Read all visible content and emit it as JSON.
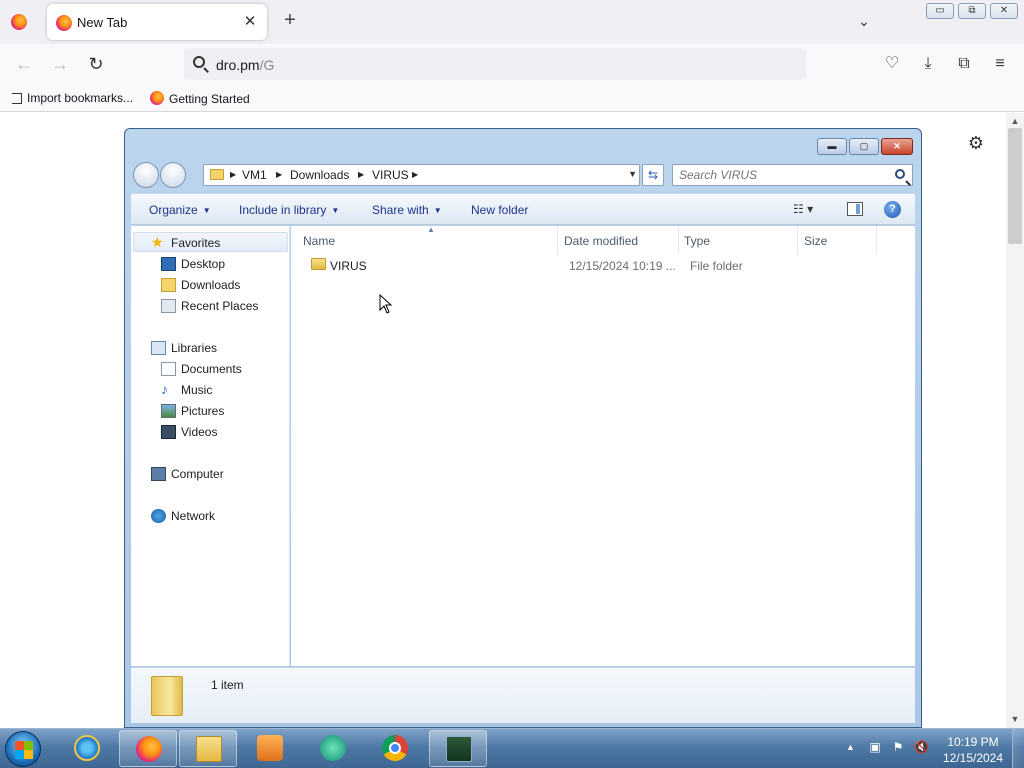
{
  "browser": {
    "tab": {
      "title": "New Tab",
      "close_glyph": "✕"
    },
    "new_tab_glyph": "+",
    "list_tabs_glyph": "⌄",
    "window_controls": {
      "minimize": "▭",
      "restore": "⧉",
      "close": "✕"
    },
    "nav": {
      "back": "←",
      "forward": "→",
      "reload": "↻"
    },
    "url": {
      "host": "dro.pm",
      "path": "/G"
    },
    "toolbar_icons": [
      "pocket-icon",
      "download-icon",
      "extensions-icon",
      "menu-icon"
    ],
    "bookmarks": [
      {
        "label": "Import bookmarks...",
        "icon": "import-icon"
      },
      {
        "label": "Getting Started",
        "icon": "firefox-icon"
      }
    ]
  },
  "explorer": {
    "window_controls": {
      "minimize": "▬",
      "maximize": "▢",
      "close": "✕"
    },
    "breadcrumb": [
      "VM1",
      "Downloads",
      "VIRUS"
    ],
    "search_placeholder": "Search VIRUS",
    "commands": {
      "organize": "Organize",
      "include": "Include in library",
      "share": "Share with",
      "new_folder": "New folder"
    },
    "nav_pane": {
      "favorites": {
        "label": "Favorites",
        "items": [
          "Desktop",
          "Downloads",
          "Recent Places"
        ]
      },
      "libraries": {
        "label": "Libraries",
        "items": [
          "Documents",
          "Music",
          "Pictures",
          "Videos"
        ]
      },
      "computer": "Computer",
      "network": "Network"
    },
    "columns": [
      "Name",
      "Date modified",
      "Type",
      "Size"
    ],
    "rows": [
      {
        "name": "VIRUS",
        "date": "12/15/2024 10:19 ...",
        "type": "File folder",
        "size": ""
      }
    ],
    "status": "1 item"
  },
  "taskbar": {
    "apps": [
      "internet-explorer",
      "firefox",
      "file-explorer",
      "media-player",
      "unknown-app",
      "chrome",
      "task-manager"
    ],
    "clock": {
      "time": "10:19 PM",
      "date": "12/15/2024"
    }
  },
  "colors": {
    "explorer_link": "#1e3287",
    "taskbar": "#4f79a6",
    "firefox_tabstrip": "#f0f0f4"
  }
}
